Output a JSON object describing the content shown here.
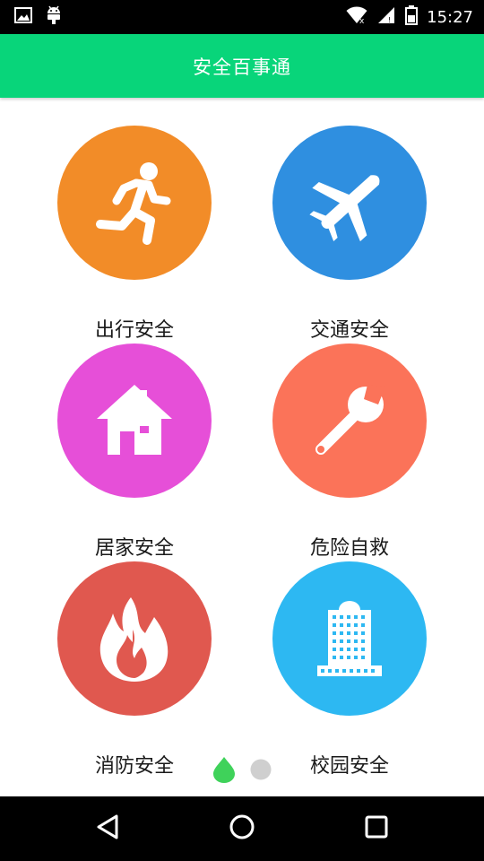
{
  "status_bar": {
    "time": "15:27",
    "left_icons": [
      "image-icon",
      "android-icon"
    ],
    "right_icons": [
      "wifi-icon",
      "cell-signal-icon",
      "battery-icon"
    ]
  },
  "app_bar": {
    "title": "安全百事通",
    "color": "#08d57a"
  },
  "grid": {
    "items": [
      {
        "label": "出行安全",
        "icon": "running-person-icon",
        "color": "#f28c28"
      },
      {
        "label": "交通安全",
        "icon": "airplane-icon",
        "color": "#2f8fe0"
      },
      {
        "label": "居家安全",
        "icon": "house-icon",
        "color": "#e64fd8"
      },
      {
        "label": "危险自救",
        "icon": "wrench-icon",
        "color": "#fb7359"
      },
      {
        "label": "消防安全",
        "icon": "flame-icon",
        "color": "#e0584f"
      },
      {
        "label": "校园安全",
        "icon": "building-icon",
        "color": "#2db8f2"
      }
    ]
  },
  "pager": {
    "pages": 2,
    "current": 1,
    "active_color": "#3fd25a",
    "inactive_color": "#cfcfcf"
  },
  "nav_bar": {
    "buttons": [
      "back-icon",
      "home-icon",
      "recents-icon"
    ]
  }
}
